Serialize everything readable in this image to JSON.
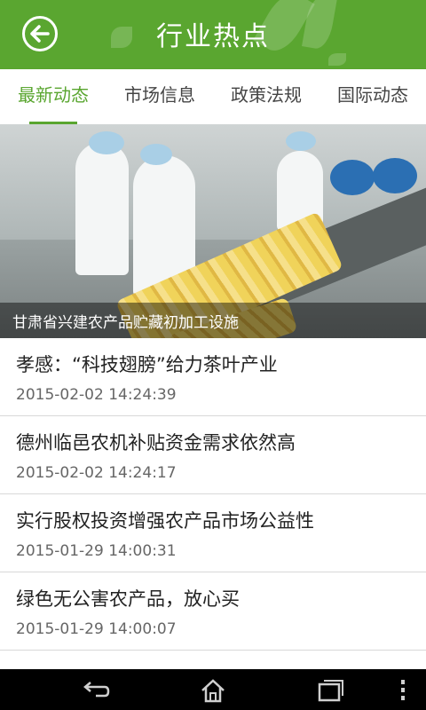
{
  "header": {
    "title": "行业热点",
    "back_icon": "back-arrow-circle-icon"
  },
  "tabs": [
    {
      "label": "最新动态",
      "active": true
    },
    {
      "label": "市场信息",
      "active": false
    },
    {
      "label": "政策法规",
      "active": false
    },
    {
      "label": "国际动态",
      "active": false
    }
  ],
  "banner": {
    "caption": "甘肃省兴建农产品贮藏初加工设施"
  },
  "news": [
    {
      "title": "孝感：“科技翅膀”给力茶叶产业",
      "date": "2015-02-02 14:24:39"
    },
    {
      "title": "德州临邑农机补贴资金需求依然高",
      "date": "2015-02-02 14:24:17"
    },
    {
      "title": "实行股权投资增强农产品市场公益性",
      "date": "2015-01-29 14:00:31"
    },
    {
      "title": "绿色无公害农产品，放心买",
      "date": "2015-01-29 14:00:07"
    }
  ],
  "navbar": {
    "icons": [
      "back-icon",
      "home-icon",
      "recent-apps-icon",
      "menu-icon"
    ]
  },
  "colors": {
    "brand": "#5aa630",
    "text": "#222222",
    "date": "#666666"
  }
}
